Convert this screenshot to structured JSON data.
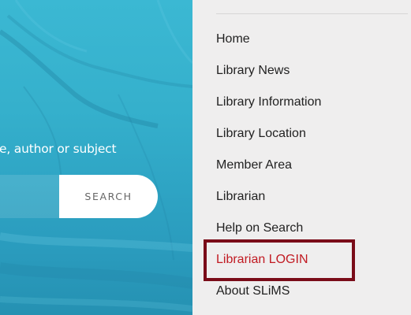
{
  "hero": {
    "prompt_text": "e, author or subject",
    "search_placeholder": "",
    "search_button_label": "SEARCH"
  },
  "menu": {
    "items": [
      {
        "label": "Home",
        "active": false
      },
      {
        "label": "Library News",
        "active": false
      },
      {
        "label": "Library Information",
        "active": false
      },
      {
        "label": "Library Location",
        "active": false
      },
      {
        "label": "Member Area",
        "active": false
      },
      {
        "label": "Librarian",
        "active": false
      },
      {
        "label": "Help on Search",
        "active": false
      },
      {
        "label": "Librarian LOGIN",
        "active": true
      },
      {
        "label": "About SLiMS",
        "active": false
      }
    ]
  },
  "colors": {
    "hero_background": "#35b0cc",
    "menu_background": "#efeeee",
    "menu_text": "#222222",
    "active_item_text": "#c11a22",
    "highlight_border": "#7a0c19",
    "search_button_background": "#ffffff"
  }
}
